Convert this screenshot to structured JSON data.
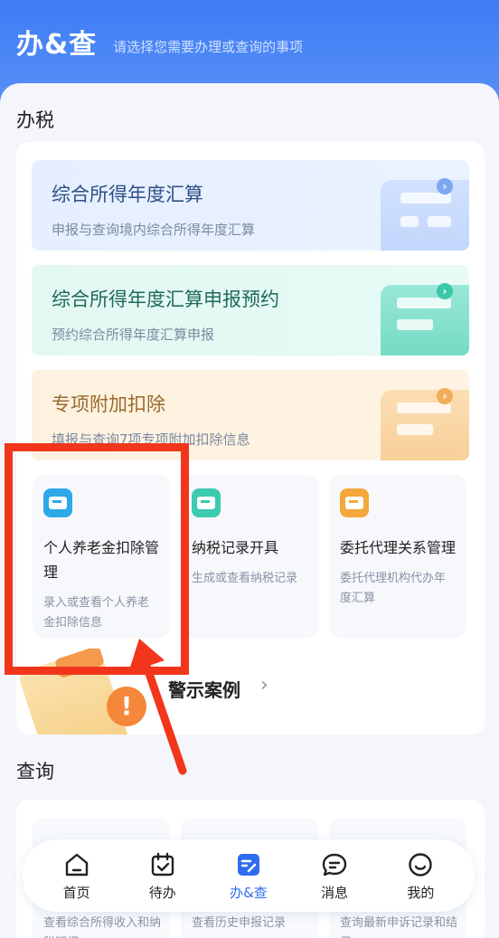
{
  "header": {
    "title": "办&查",
    "subtitle": "请选择您需要办理或查询的事项"
  },
  "tax_section": {
    "title": "办税",
    "banners": [
      {
        "title": "综合所得年度汇算",
        "subtitle": "申报与查询境内综合所得年度汇算"
      },
      {
        "title": "综合所得年度汇算申报预约",
        "subtitle": "预约综合所得年度汇算申报"
      },
      {
        "title": "专项附加扣除",
        "subtitle": "填报与查询7项专项附加扣除信息"
      }
    ],
    "tiles": [
      {
        "title": "个人养老金扣除管理",
        "subtitle": "录入或查看个人养老金扣除信息",
        "icon": "pension-card-icon"
      },
      {
        "title": "纳税记录开具",
        "subtitle": "生成或查看纳税记录",
        "icon": "tax-record-icon"
      },
      {
        "title": "委托代理关系管理",
        "subtitle": "委托代理机构代办年度汇算",
        "icon": "agent-hand-icon"
      }
    ],
    "warning": {
      "label": "警示案例"
    }
  },
  "query_section": {
    "title": "查询",
    "tiles": [
      {
        "subtitle": "查看综合所得收入和纳税明细"
      },
      {
        "subtitle": "查看历史申报记录"
      },
      {
        "subtitle": "查询最新申诉记录和结果"
      }
    ]
  },
  "tabbar": {
    "items": [
      {
        "label": "首页",
        "icon": "home-icon"
      },
      {
        "label": "待办",
        "icon": "calendar-check-icon"
      },
      {
        "label": "办&查",
        "icon": "do-query-icon",
        "active": true
      },
      {
        "label": "消息",
        "icon": "message-icon"
      },
      {
        "label": "我的",
        "icon": "smile-icon"
      }
    ]
  },
  "colors": {
    "brand_blue": "#3d7cf5",
    "active_tab": "#2f6cf0",
    "annotation_red": "#f2361c"
  }
}
